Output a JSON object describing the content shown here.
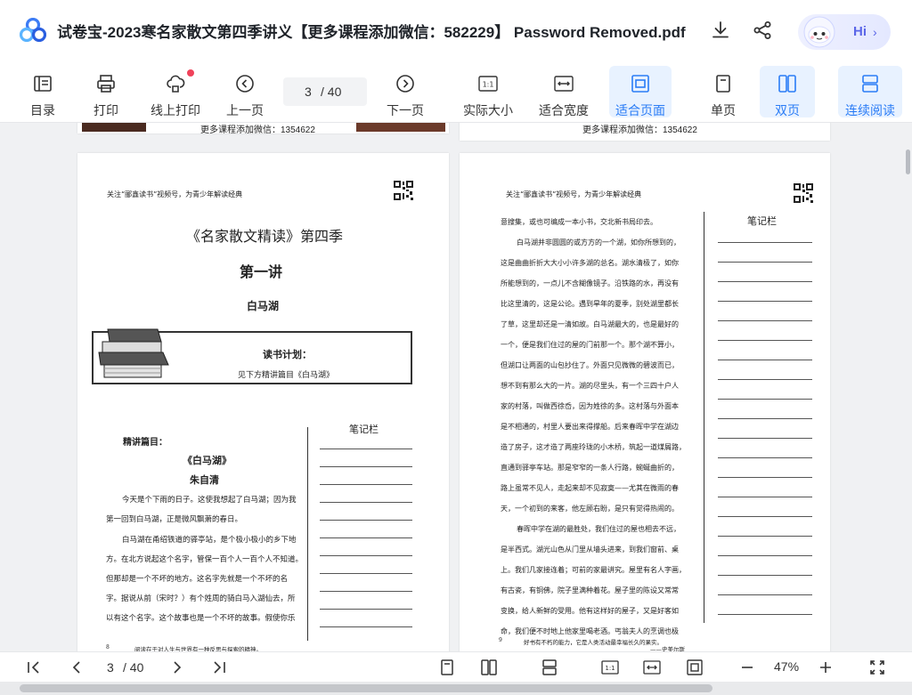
{
  "window": {
    "title": "试卷宝-2023寒名家散文第四季讲义【更多课程添加微信：582229】 Password Removed.pdf"
  },
  "assistant": {
    "label": "Hi"
  },
  "toolbar": {
    "toc": "目录",
    "print": "打印",
    "online_print": "线上打印",
    "prev": "上一页",
    "current_page": "3",
    "total_pages": "/ 40",
    "next": "下一页",
    "actual_size": "实际大小",
    "fit_width": "适合宽度",
    "fit_page": "适合页面",
    "single": "单页",
    "double": "双页",
    "continuous": "连续阅读"
  },
  "pages": {
    "prev_footer_left": "更多课程添加微信：1354622",
    "prev_footer_right": "更多课程添加微信：1354622",
    "left": {
      "header": "关注“郦鑫读书”视频号，为青少年解读经典",
      "title": "《名家散文精读》第四季",
      "lecture": "第一讲",
      "topic": "白马湖",
      "plan_title": "读书计划：",
      "plan_text": "见下方精讲篇目《白马湖》",
      "notes_label": "笔记栏",
      "section_label": "精讲篇目：",
      "essay_title": "《白马湖》",
      "author": "朱自清",
      "paragraphs": [
        "今天是个下雨的日子。这使我想起了白马湖；因为我",
        "第一回到白马湖，正是微风飘萧的春日。",
        "白马湖在甬绍铁道的驿亭站，是个极小极小的乡下地",
        "方。在北方说起这个名字，管保一百个人一百个人不知道。",
        "但那却是一个不坏的地方。这名字先就是一个不坏的名",
        "字。据说从前（宋时？）有个姓周的骑白马入湖仙去，所",
        "以有这个名字。这个故事也是一个不坏的故事。假使你乐"
      ],
      "footer_num": "8",
      "footer_text": "阅读在于对人生与世界有一种反思与探索的精神。"
    },
    "right": {
      "header": "关注“郦鑫读书”视频号，为青少年解读经典",
      "notes_label": "笔记栏",
      "paragraphs": [
        "意搜集，或也可编成一本小书，交北新书局印去。",
        "白马湖并非圆圆的或方方的一个湖，如你所想到的，",
        "这是曲曲折折大大小小许多湖的总名。湖水清极了，如你",
        "所能想到的，一点儿不含糊像镜子。沿铁路的水，再没有",
        "比这里清的，这是公论。遇到旱年的夏季，别处湖里都长",
        "了草，这里却还是一清如故。白马湖最大的，也是最好的",
        "一个，便是我们住过的屋的门前那一个。那个湖不算小，",
        "但湖口让两面的山包抄住了。外面只见微微的碧波而已，",
        "想不到有那么大的一片。湖的尽里头，有一个三四十户人",
        "家的村落，叫做西徐岙，因为姓徐的多。这村落与外面本",
        "是不相通的，村里人要出来得撑船。后来春晖中学在湖边",
        "造了房子，这才造了两座玲珑的小木桥，筑起一道煤屑路，",
        "直通到驿亭车站。那是窄窄的一条人行路，蜿蜒曲折的，",
        "路上虽常不见人，走起来却不见寂寞——尤其在微雨的春",
        "天，一个初到的来客，他左顾右盼，是只有觉得热闹的。",
        "春晖中学在湖的最胜处，我们住过的屋也相去不远，",
        "是半西式。湖光山色从门里从墙头进来，到我们窗前、桌",
        "上。我们几家接连着；可前的家最讲究。屋里有名人字画，",
        "有古瓷，有铜佛，院子里满种着花。屋子里的陈设又常常",
        "变换，给人新鲜的受用。他有这样好的屋子，又是好客如",
        "命，我们便不时地上他家里喝老酒。丐翁夫人的烹调也极"
      ],
      "footer_num": "9",
      "footer_text": "好书有不朽的能力，它是人类活动最幸福长久的果实。",
      "footer_attrib": "——史美尔斯"
    }
  },
  "bottombar": {
    "current_page": "3",
    "total_pages": "/ 40",
    "zoom": "47%"
  }
}
